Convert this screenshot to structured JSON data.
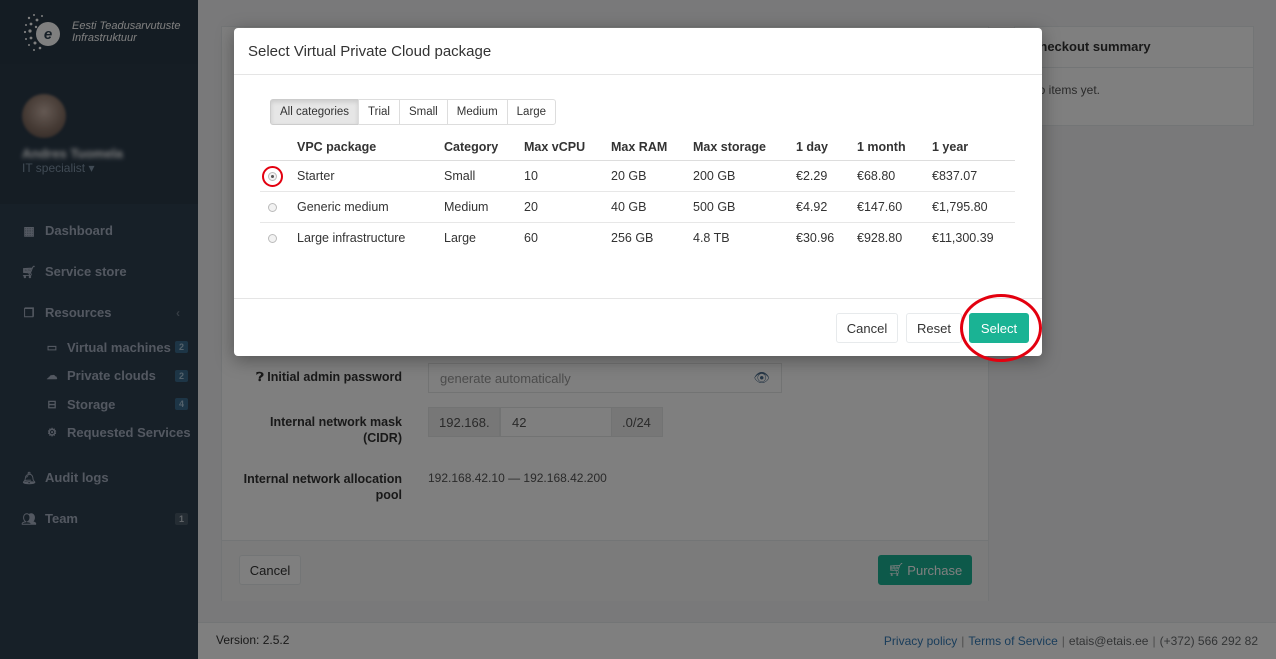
{
  "app": {
    "org_line1": "Eesti Teadusarvutuste",
    "org_line2": "Infrastruktuur"
  },
  "profile": {
    "name": "Andres Tuomela",
    "role": "IT specialist ▾"
  },
  "nav": {
    "dashboard": "Dashboard",
    "service_store": "Service store",
    "resources": "Resources",
    "virtual_machines": "Virtual machines",
    "virtual_machines_count": "2",
    "private_clouds": "Private clouds",
    "private_clouds_count": "2",
    "storage": "Storage",
    "storage_count": "4",
    "requested_services": "Requested Services",
    "audit_logs": "Audit logs",
    "team": "Team",
    "team_count": "1"
  },
  "form": {
    "admin_password_label": "Initial admin password",
    "admin_password_placeholder": "generate automatically",
    "network_mask_label": "Internal network mask (CIDR)",
    "network_prefix": "192.168.",
    "network_value": "42",
    "network_suffix": ".0/24",
    "pool_label": "Internal network allocation pool",
    "pool_value": "192.168.42.10 — 192.168.42.200",
    "cancel": "Cancel",
    "purchase": "Purchase"
  },
  "summary": {
    "title": "Checkout summary",
    "empty": "No items yet."
  },
  "footer": {
    "version": "Version: 2.5.2",
    "privacy": "Privacy policy",
    "terms": "Terms of Service",
    "email": "etais@etais.ee",
    "phone": "(+372) 566 292 82"
  },
  "modal": {
    "title": "Select Virtual Private Cloud package",
    "filters": [
      "All categories",
      "Trial",
      "Small",
      "Medium",
      "Large"
    ],
    "columns": [
      "VPC package",
      "Category",
      "Max vCPU",
      "Max RAM",
      "Max storage",
      "1 day",
      "1 month",
      "1 year"
    ],
    "rows": [
      [
        "Starter",
        "Small",
        "10",
        "20 GB",
        "200 GB",
        "€2.29",
        "€68.80",
        "€837.07"
      ],
      [
        "Generic medium",
        "Medium",
        "20",
        "40 GB",
        "500 GB",
        "€4.92",
        "€147.60",
        "€1,795.80"
      ],
      [
        "Large infrastructure",
        "Large",
        "60",
        "256 GB",
        "4.8 TB",
        "€30.96",
        "€928.80",
        "€11,300.39"
      ]
    ],
    "selected_row": 0,
    "cancel": "Cancel",
    "reset": "Reset",
    "select": "Select"
  },
  "colors": {
    "sidebar": "#2f4050",
    "primary": "#1ab394",
    "highlight": "#e3000f"
  }
}
